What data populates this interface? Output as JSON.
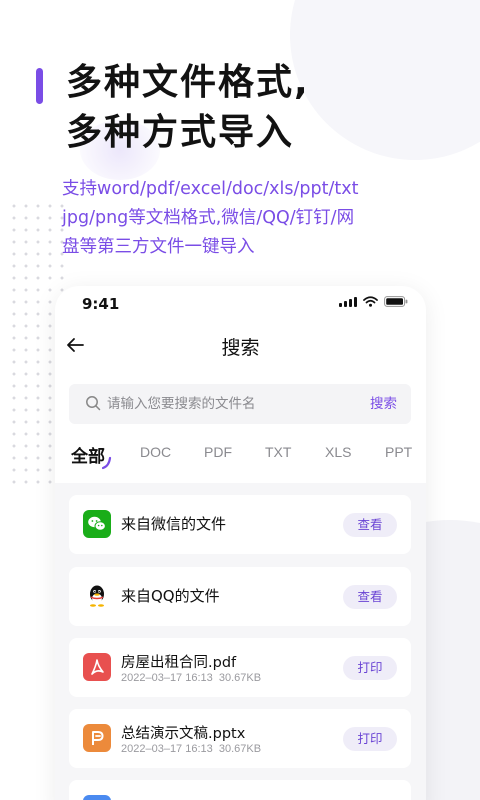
{
  "headline": {
    "line1": "多种文件格式,",
    "line2": "多种方式导入"
  },
  "description": {
    "line1": "支持word/pdf/excel/doc/xls/ppt/txt",
    "line2": "jpg/png等文档格式,微信/QQ/钉钉/网",
    "line3": "盘等第三方文件一键导入"
  },
  "status_bar": {
    "time": "9:41"
  },
  "nav": {
    "title": "搜索"
  },
  "search": {
    "placeholder": "请输入您要搜索的文件名",
    "button_label": "搜索"
  },
  "tabs": [
    {
      "label": "全部",
      "active": true
    },
    {
      "label": "DOC"
    },
    {
      "label": "PDF"
    },
    {
      "label": "TXT"
    },
    {
      "label": "XLS"
    },
    {
      "label": "PPT"
    }
  ],
  "items": [
    {
      "title": "来自微信的文件",
      "icon": "wechat-icon",
      "action": "查看"
    },
    {
      "title": "来自QQ的文件",
      "icon": "qq-icon",
      "action": "查看"
    },
    {
      "title": "房屋出租合同.pdf",
      "date": "2022–03–17 16:13",
      "size": "30.67KB",
      "icon": "pdf-file-icon",
      "action": "打印"
    },
    {
      "title": "总结演示文稿.pptx",
      "date": "2022–03–17 16:13",
      "size": "30.67KB",
      "icon": "ppt-file-icon",
      "action": "打印"
    }
  ],
  "colors": {
    "accent": "#7a4de6",
    "wechat": "#1aad19",
    "pdf": "#e8504f",
    "ppt": "#ec8a3b"
  }
}
